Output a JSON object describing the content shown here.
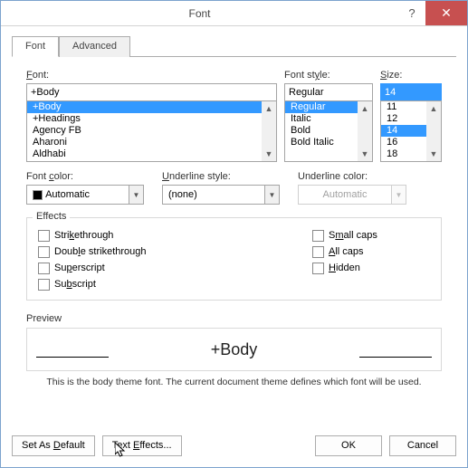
{
  "window": {
    "title": "Font"
  },
  "tabs": {
    "font": "Font",
    "advanced": "Advanced"
  },
  "labels": {
    "font": "Font:",
    "fontStyle": "Font style:",
    "size": "Size:",
    "fontColor": "Font color:",
    "underlineStyle": "Underline style:",
    "underlineColor": "Underline color:",
    "effects": "Effects",
    "preview": "Preview"
  },
  "font": {
    "value": "+Body",
    "list": [
      "+Body",
      "+Headings",
      "Agency FB",
      "Aharoni",
      "Aldhabi"
    ],
    "selectedIndex": 0
  },
  "fontStyle": {
    "value": "Regular",
    "list": [
      "Regular",
      "Italic",
      "Bold",
      "Bold Italic"
    ],
    "selectedIndex": 0
  },
  "size": {
    "value": "14",
    "list": [
      "11",
      "12",
      "14",
      "16",
      "18"
    ],
    "selectedIndex": 2
  },
  "fontColor": {
    "value": "Automatic"
  },
  "underlineStyle": {
    "value": "(none)"
  },
  "underlineColor": {
    "value": "Automatic"
  },
  "effects": {
    "strikethrough": "Strikethrough",
    "doubleStrikethrough": "Double strikethrough",
    "superscript": "Superscript",
    "subscript": "Subscript",
    "smallCaps": "Small caps",
    "allCaps": "All caps",
    "hidden": "Hidden"
  },
  "preview": {
    "sample": "+Body"
  },
  "hint": "This is the body theme font. The current document theme defines which font will be used.",
  "buttons": {
    "setDefault": "Set As Default",
    "textEffects": "Text Effects...",
    "ok": "OK",
    "cancel": "Cancel"
  }
}
